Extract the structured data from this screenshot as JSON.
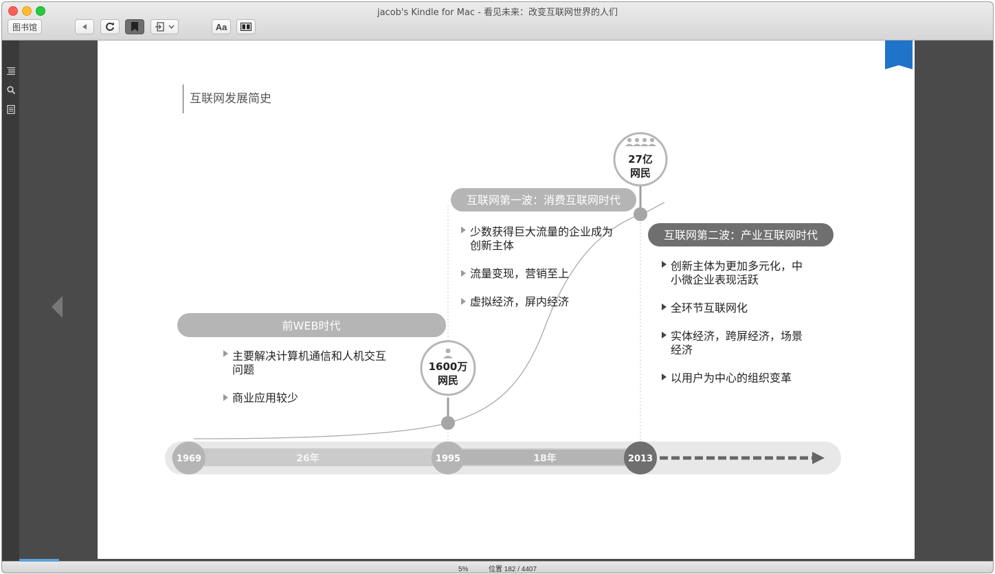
{
  "window": {
    "title": "jacob's Kindle for Mac - 看见未来：改变互联网世界的人们"
  },
  "toolbar": {
    "library_label": "图书馆",
    "font_label": "Aa",
    "icons": [
      "back-icon",
      "sync-icon",
      "bookmark-icon",
      "goto-icon",
      "chevron-down-icon",
      "font-icon",
      "columns-icon"
    ]
  },
  "sidebar": {
    "icons": [
      "toc-icon",
      "search-icon",
      "notes-icon"
    ]
  },
  "page": {
    "chapter_title": "互联网发展简史"
  },
  "diagram": {
    "eras": [
      {
        "label": "前WEB时代",
        "bullets": [
          [
            "主要解决计算机通信和人机交互",
            "问题"
          ],
          [
            "商业应用较少"
          ]
        ]
      },
      {
        "label": "互联网第一波：消费互联网时代",
        "bullets": [
          [
            "少数获得巨大流量的企业成为",
            "创新主体"
          ],
          [
            "流量变现，营销至上"
          ],
          [
            "虚拟经济，屏内经济"
          ]
        ]
      },
      {
        "label": "互联网第二波：产业互联网时代",
        "bullets": [
          [
            "创新主体为更加多元化，中",
            "小微企业表现活跃"
          ],
          [
            "全环节互联网化"
          ],
          [
            "实体经济，跨屏经济，场景",
            "经济"
          ],
          [
            "以用户为中心的组织变革"
          ]
        ]
      }
    ],
    "milestones": [
      {
        "value": "1600万",
        "unit": "网民"
      },
      {
        "value": "27亿",
        "unit": "网民"
      }
    ],
    "years": [
      "1969",
      "1995",
      "2013"
    ],
    "spans": [
      "26年",
      "18年"
    ],
    "colors": {
      "pill_light": "#b5b5b5",
      "pill_dark": "#6f6f6f",
      "timeline_bg": "#e8e8e8",
      "curve": "#a8a8a8"
    }
  },
  "status": {
    "percent": "5%",
    "location": "位置 182 / 4407",
    "progress_fraction": 0.05
  }
}
